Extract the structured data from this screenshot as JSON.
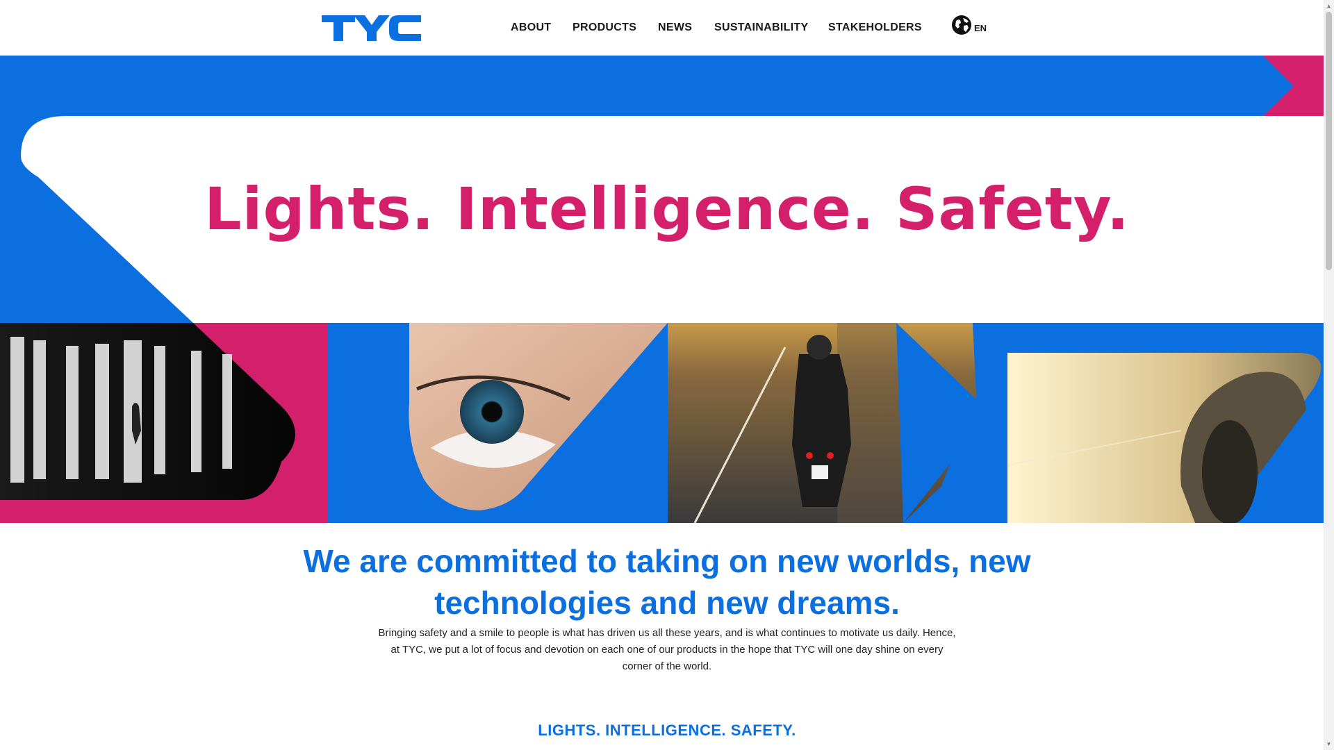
{
  "header": {
    "logo_text": "TYC",
    "nav": [
      {
        "label": "ABOUT"
      },
      {
        "label": "PRODUCTS"
      },
      {
        "label": "NEWS"
      },
      {
        "label": "SUSTAINABILITY"
      },
      {
        "label": "STAKEHOLDERS"
      }
    ],
    "language": {
      "label": "EN",
      "icon": "globe-icon"
    }
  },
  "hero": {
    "headline": "Lights. Intelligence. Safety.",
    "images": [
      "light-bars-corridor-image",
      "blue-eye-image",
      "motorcycle-road-image",
      "car-wheel-sunset-image"
    ]
  },
  "main": {
    "heading": "We are committed to taking on new worlds, new technologies and new dreams.",
    "intro": "Bringing safety and a smile to people is what has driven us all these years, and is what continues to motivate us daily. Hence, at TYC, we put a lot of focus and devotion on each one of our products in the hope that TYC will one day shine on every corner of the world.",
    "tagline": "LIGHTS. INTELLIGENCE. SAFETY."
  },
  "colors": {
    "brand_blue": "#0b6fe0",
    "brand_pink": "#d4206b"
  }
}
